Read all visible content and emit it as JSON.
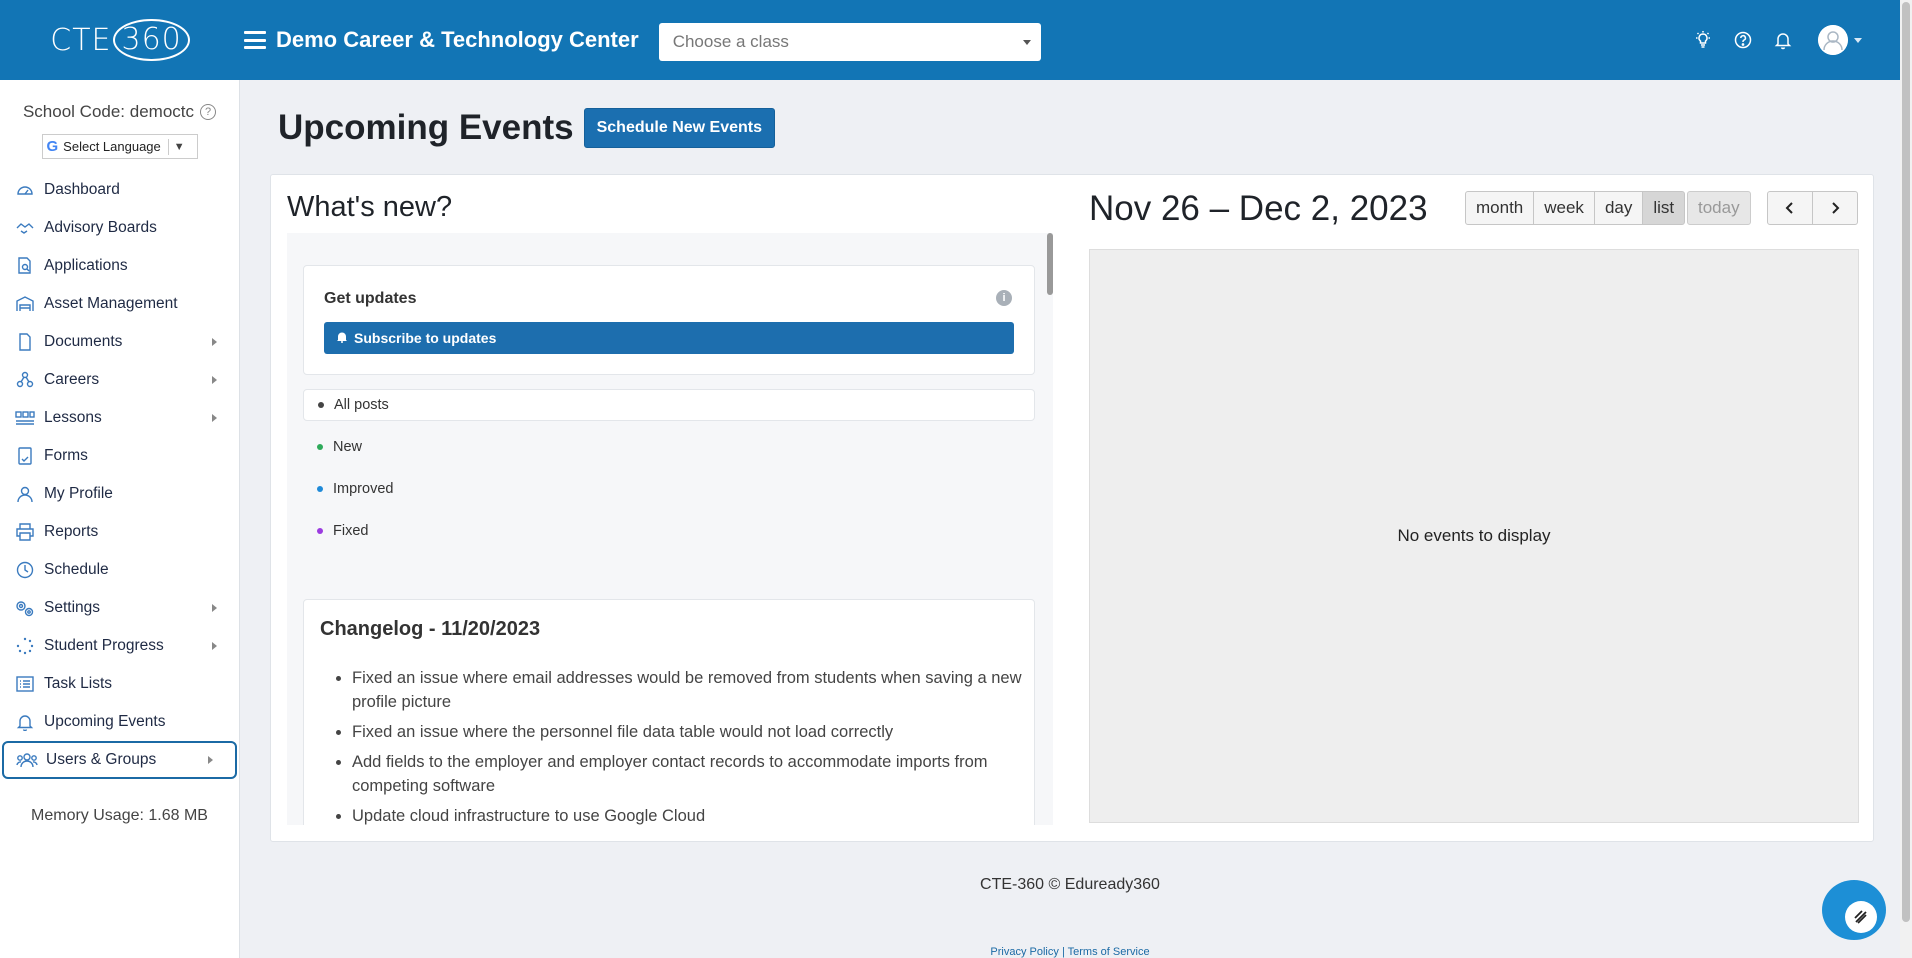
{
  "header": {
    "logo_text": "CTE",
    "logo_ring_text": "360",
    "org_name": "Demo Career & Technology Center",
    "class_select": {
      "placeholder": "Choose a class"
    },
    "icons": [
      "lightbulb-icon",
      "help-icon",
      "bell-icon",
      "user-avatar"
    ],
    "brand_color": "#1275b5"
  },
  "sidebar": {
    "school_code": "School Code: democtc",
    "language_label": "Select Language",
    "items": [
      {
        "label": "Dashboard",
        "icon": "dashboard-icon",
        "has_submenu": false
      },
      {
        "label": "Advisory Boards",
        "icon": "handshake-icon",
        "has_submenu": false
      },
      {
        "label": "Applications",
        "icon": "document-search-icon",
        "has_submenu": false
      },
      {
        "label": "Asset Management",
        "icon": "warehouse-icon",
        "has_submenu": false
      },
      {
        "label": "Documents",
        "icon": "file-icon",
        "has_submenu": true
      },
      {
        "label": "Careers",
        "icon": "network-icon",
        "has_submenu": true
      },
      {
        "label": "Lessons",
        "icon": "lessons-icon",
        "has_submenu": true
      },
      {
        "label": "Forms",
        "icon": "form-icon",
        "has_submenu": false
      },
      {
        "label": "My Profile",
        "icon": "user-icon",
        "has_submenu": false
      },
      {
        "label": "Reports",
        "icon": "printer-icon",
        "has_submenu": false
      },
      {
        "label": "Schedule",
        "icon": "clock-icon",
        "has_submenu": false
      },
      {
        "label": "Settings",
        "icon": "gears-icon",
        "has_submenu": true
      },
      {
        "label": "Student Progress",
        "icon": "progress-icon",
        "has_submenu": true
      },
      {
        "label": "Task Lists",
        "icon": "list-icon",
        "has_submenu": false
      },
      {
        "label": "Upcoming Events",
        "icon": "bell-icon",
        "has_submenu": false
      },
      {
        "label": "Users & Groups",
        "icon": "users-icon",
        "has_submenu": true,
        "active": true
      }
    ],
    "memory_usage": "Memory Usage: 1.68 MB"
  },
  "main": {
    "title": "Upcoming Events",
    "schedule_button": "Schedule New Events",
    "whats_new": {
      "title": "What's new?",
      "get_updates_title": "Get updates",
      "subscribe_label": "Subscribe to updates",
      "filters": [
        {
          "label": "All posts",
          "color": "#444444",
          "selected": true
        },
        {
          "label": "New",
          "color": "#2eaa5a",
          "selected": false
        },
        {
          "label": "Improved",
          "color": "#1f8ad8",
          "selected": false
        },
        {
          "label": "Fixed",
          "color": "#9b3be0",
          "selected": false
        }
      ],
      "changelog_title": "Changelog - 11/20/2023",
      "changelog_items": [
        "Fixed an issue where email addresses would be removed from students when saving a new profile picture",
        "Fixed an issue where the personnel file data table would not load correctly",
        "Add fields to the employer and employer contact records to accommodate imports from competing software",
        "Update cloud infrastructure to use Google Cloud"
      ]
    },
    "calendar": {
      "range_title": "Nov 26 – Dec 2, 2023",
      "views": [
        "month",
        "week",
        "day",
        "list"
      ],
      "active_view": "list",
      "today_label": "today",
      "empty_text": "No events to display"
    }
  },
  "footer": {
    "copyright": "CTE-360 © Eduready360",
    "privacy_label": "Privacy Policy",
    "separator": "|",
    "terms_label": "Terms of Service"
  }
}
